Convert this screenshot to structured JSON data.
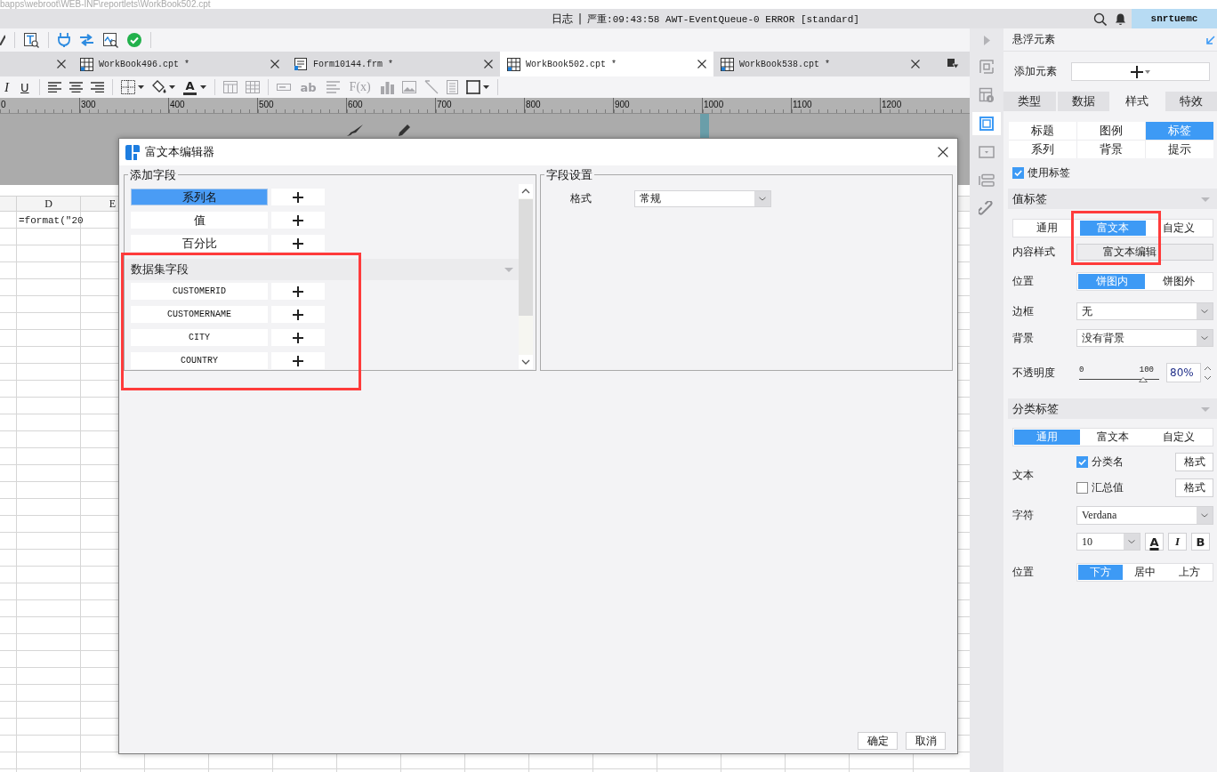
{
  "path_bar": {
    "text": "bapps\\webroot\\WEB-INF\\reportlets\\WorkBook502.cpt"
  },
  "status_bar": {
    "log_button": "日志",
    "separator": "|",
    "message": "严重:09:43:58 AWT-EventQueue-0 ERROR [standard]",
    "user": "snrtuemc"
  },
  "tabs": [
    {
      "selected": false
    },
    {
      "label": "WorkBook496.cpt *",
      "kind": "workbook",
      "selected": false
    },
    {
      "label": "Form10144.frm *",
      "kind": "form",
      "selected": false
    },
    {
      "label": "WorkBook502.cpt *",
      "kind": "workbook",
      "selected": true
    },
    {
      "label": "WorkBook538.cpt *",
      "kind": "workbook",
      "selected": false
    }
  ],
  "format_toolbar": {
    "italic": "I",
    "underline": "U",
    "font_color": "A",
    "text_field": "ab",
    "formula": "F(x)"
  },
  "ruler": {
    "marks": [
      "0",
      "300",
      "400",
      "500",
      "600",
      "700",
      "800",
      "900",
      "1000",
      "1100",
      "1200"
    ]
  },
  "sheet": {
    "columns": [
      "D",
      "E"
    ],
    "rows": [
      [
        "=format(\"20"
      ]
    ]
  },
  "dialog": {
    "title": "富文本编辑器",
    "add_fields": {
      "legend": "添加字段",
      "fields": [
        {
          "label": "系列名",
          "selected": true
        },
        {
          "label": "值",
          "selected": false
        },
        {
          "label": "百分比",
          "selected": false
        }
      ],
      "dataset_header": "数据集字段",
      "dataset_expanded": true,
      "dataset_fields": [
        {
          "label": "CUSTOMERID",
          "selected": false
        },
        {
          "label": "CUSTOMERNAME",
          "selected": false
        },
        {
          "label": "CITY",
          "selected": false
        },
        {
          "label": "COUNTRY",
          "selected": false
        }
      ]
    },
    "field_settings": {
      "legend": "字段设置",
      "format_label": "格式",
      "format_value": "常规"
    },
    "buttons": [
      "确定",
      "取消"
    ]
  },
  "rail": [
    {
      "selected": false
    },
    {
      "selected": false
    },
    {
      "selected": true
    },
    {
      "selected": false
    },
    {
      "selected": false
    },
    {
      "selected": false
    }
  ],
  "panel": {
    "title": "悬浮元素",
    "add_element_label": "添加元素",
    "tabs": [
      {
        "label": "类型",
        "selected": false
      },
      {
        "label": "数据",
        "selected": false
      },
      {
        "label": "样式",
        "selected": true
      },
      {
        "label": "特效",
        "selected": false
      }
    ],
    "subtabs": [
      {
        "label": "标题",
        "selected": false
      },
      {
        "label": "图例",
        "selected": false
      },
      {
        "label": "标签",
        "selected": true
      },
      {
        "label": "系列",
        "selected": false
      },
      {
        "label": "背景",
        "selected": false
      },
      {
        "label": "提示",
        "selected": false
      }
    ],
    "use_label": {
      "label": "使用标签",
      "checked": true
    },
    "value_label": {
      "header": "值标签",
      "expanded": true,
      "modes": [
        {
          "label": "通用",
          "selected": false
        },
        {
          "label": "富文本",
          "selected": true
        },
        {
          "label": "自定义",
          "selected": false
        }
      ],
      "content_style_label": "内容样式",
      "content_style_button": "富文本编辑",
      "position_label": "位置",
      "positions": [
        {
          "label": "饼图内",
          "selected": true
        },
        {
          "label": "饼图外",
          "selected": false
        }
      ],
      "border_label": "边框",
      "border_value": "无",
      "background_label": "背景",
      "background_value": "没有背景",
      "opacity_label": "不透明度",
      "opacity_min": "0",
      "opacity_max": "100",
      "opacity_slider": {
        "level": 0.8
      },
      "opacity_value": "80%"
    },
    "category_label": {
      "header": "分类标签",
      "expanded": true,
      "modes": [
        {
          "label": "通用",
          "selected": true
        },
        {
          "label": "富文本",
          "selected": false
        },
        {
          "label": "自定义",
          "selected": false
        }
      ],
      "text_label": "文本",
      "options": [
        {
          "label": "分类名",
          "checked": true,
          "button": "格式"
        },
        {
          "label": "汇总值",
          "checked": false,
          "button": "格式"
        }
      ],
      "font_label": "字符",
      "font_value": "Verdana",
      "size_value": "10",
      "style_buttons": {
        "font_color": "A",
        "italic": "I",
        "bold": "B"
      },
      "position_label": "位置",
      "positions": [
        {
          "label": "下方",
          "selected": true
        },
        {
          "label": "居中",
          "selected": false
        },
        {
          "label": "上方",
          "selected": false
        }
      ]
    }
  }
}
